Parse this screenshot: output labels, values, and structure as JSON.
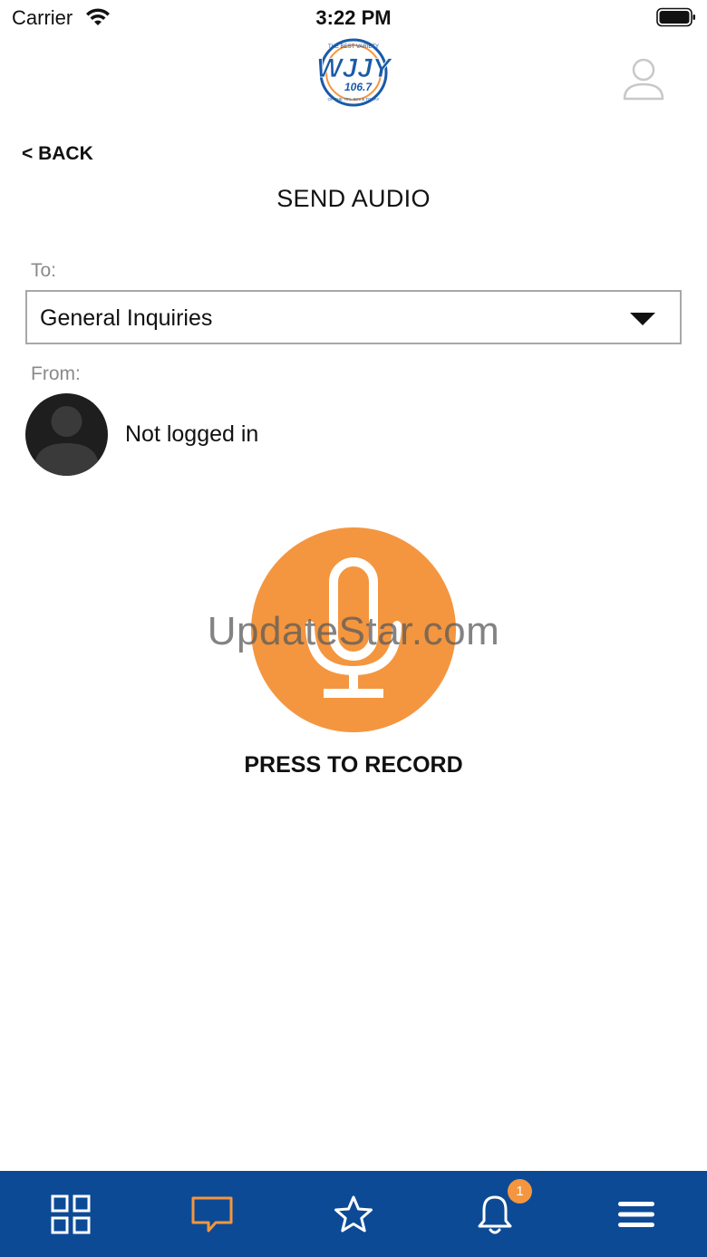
{
  "status_bar": {
    "carrier": "Carrier",
    "time": "3:22 PM"
  },
  "header": {
    "logo_text": "WJJY",
    "logo_frequency": "106.7",
    "logo_tagline_top": "THE BEST VARIETY",
    "logo_tagline_bottom": "OF THE 70's, 80's & TODAY",
    "back_label": "< BACK",
    "page_title": "SEND AUDIO"
  },
  "form": {
    "to_label": "To:",
    "recipient": "General Inquiries",
    "from_label": "From:",
    "sender_status": "Not logged in"
  },
  "recorder": {
    "button_label": "PRESS TO RECORD",
    "watermark": "UpdateStar.com"
  },
  "tab_bar": {
    "active_tab": "messages",
    "notification_count": "1"
  },
  "colors": {
    "accent": "#f4963f",
    "tab_bar_bg": "#0c4a96",
    "logo_blue": "#1a5aa8"
  }
}
